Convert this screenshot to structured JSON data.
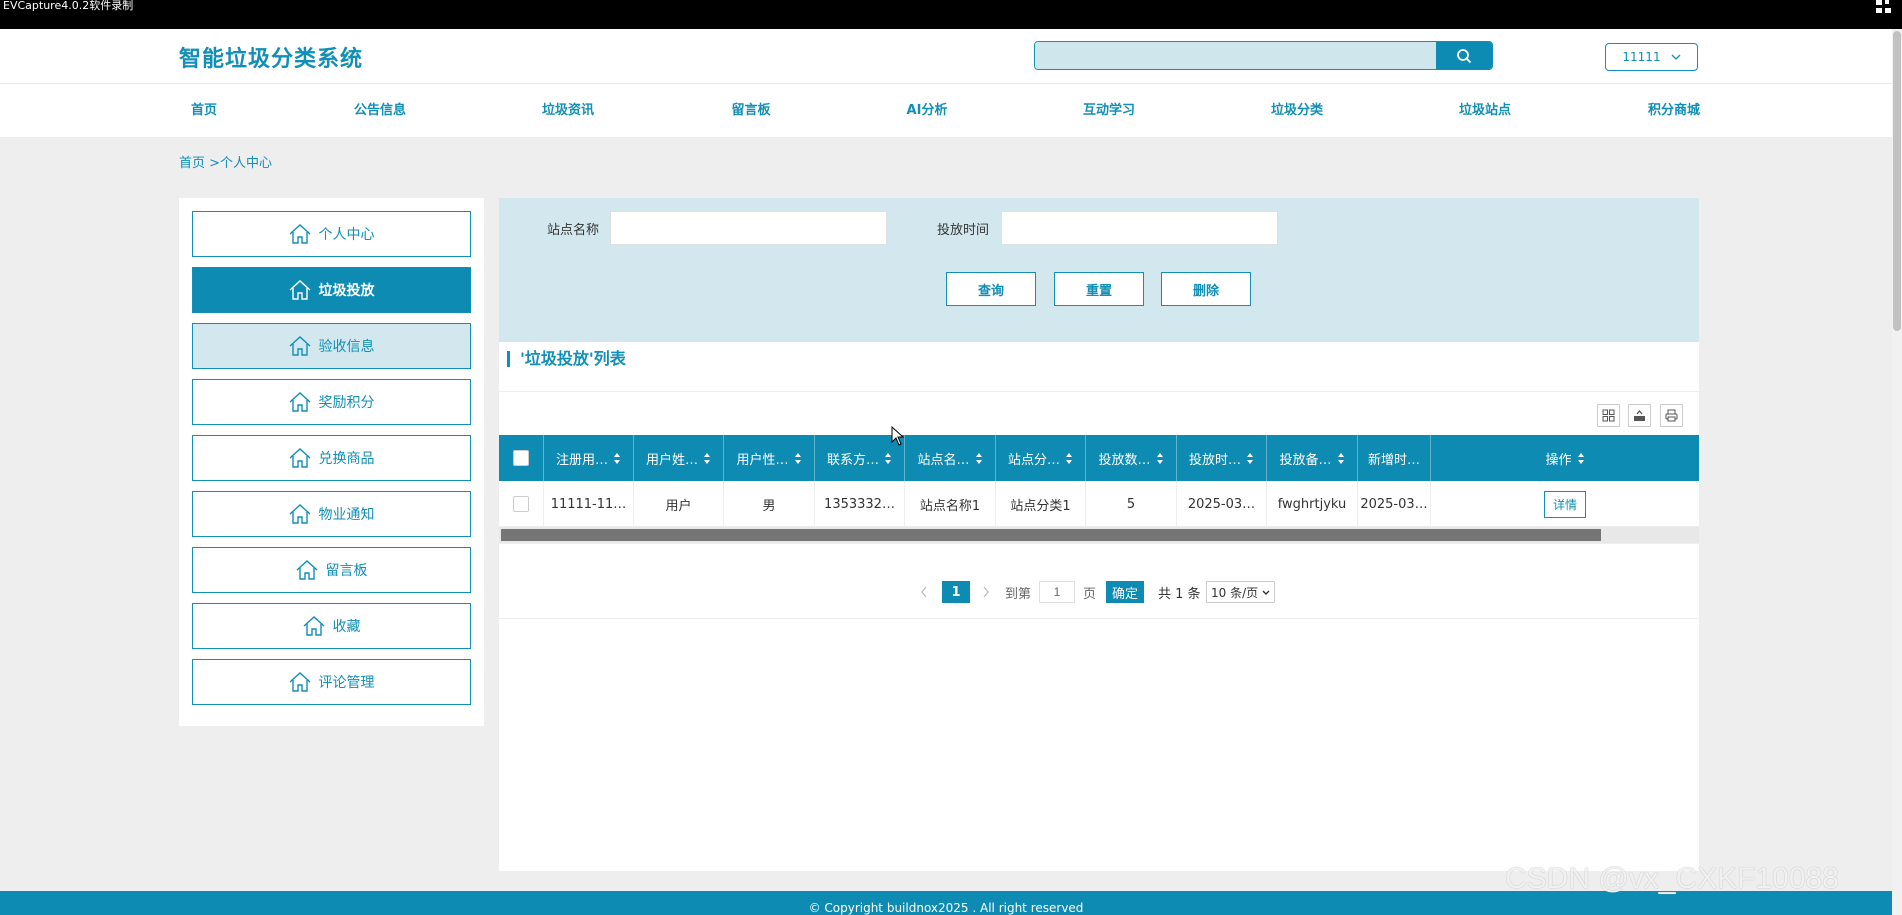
{
  "recorder": {
    "title": "EVCapture4.0.2软件录制"
  },
  "header": {
    "brand": "智能垃圾分类系统",
    "search_placeholder": "",
    "user_label": "11111"
  },
  "nav": [
    "首页",
    "公告信息",
    "垃圾资讯",
    "留言板",
    "AI分析",
    "互动学习",
    "垃圾分类",
    "垃圾站点",
    "积分商城"
  ],
  "breadcrumb": "首页 >个人中心",
  "sidebar": {
    "items": [
      "个人中心",
      "垃圾投放",
      "验收信息",
      "奖励积分",
      "兑换商品",
      "物业通知",
      "留言板",
      "收藏",
      "评论管理"
    ],
    "active": "垃圾投放"
  },
  "filter": {
    "station_label": "站点名称",
    "station_value": "",
    "time_label": "投放时间",
    "time_value": "",
    "query_label": "查询",
    "reset_label": "重置",
    "delete_label": "删除"
  },
  "list_title": "'垃圾投放'列表",
  "table": {
    "headers": [
      "注册用…",
      "用户姓…",
      "用户性…",
      "联系方…",
      "站点名…",
      "站点分…",
      "投放数…",
      "投放时…",
      "投放备…",
      "新增时…",
      "操作"
    ],
    "rows": [
      [
        "11111-11…",
        "用户",
        "男",
        "1353332…",
        "站点名称1",
        "站点分类1",
        "5",
        "2025-03…",
        "fwghrtjyku",
        "2025-03…"
      ]
    ],
    "detail_label": "详情"
  },
  "pager": {
    "current": "1",
    "goto_label": "到第",
    "goto_value": "1",
    "page_unit": "页",
    "ok_label": "确定",
    "total": "共 1 条",
    "per_page": "10 条/页"
  },
  "footer": "© Copyright buildnox2025 . All right reserved",
  "watermark": "CSDN @vx_CXKF10088",
  "colors": {
    "primary": "#0e8bb2",
    "light": "#d2e8ee"
  }
}
